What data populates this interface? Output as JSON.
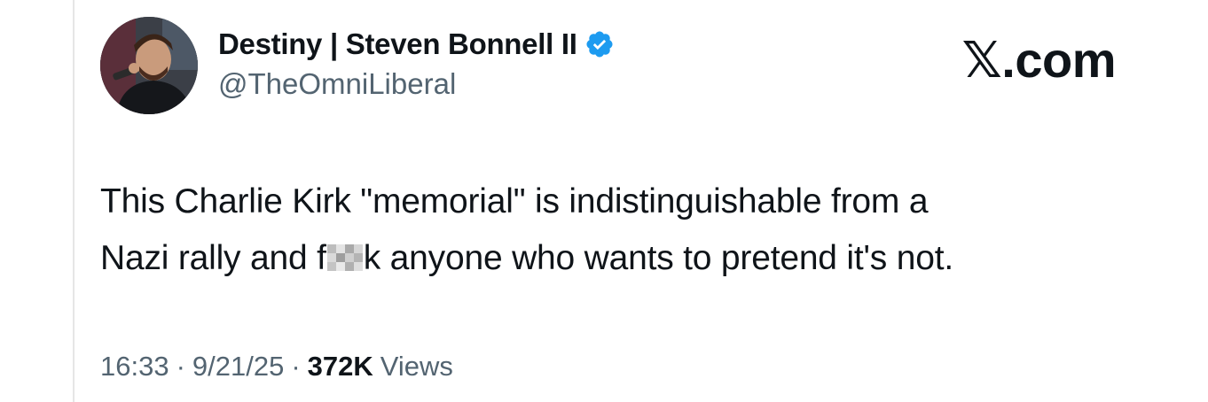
{
  "author": {
    "display_name": "Destiny | Steven Bonnell II",
    "handle": "@TheOmniLiberal",
    "verified_icon": "verified-badge-icon"
  },
  "brand": {
    "label": "𝕏.com"
  },
  "tweet": {
    "line1": "This Charlie Kirk \"memorial\" is indistinguishable from a",
    "line2_before": "Nazi rally and f",
    "line2_after": "k anyone who wants to pretend it's not."
  },
  "meta": {
    "time": "16:33",
    "separator": "·",
    "date": "9/21/25",
    "views_count": "372K",
    "views_label": "Views"
  },
  "colors": {
    "text_primary": "#0f1419",
    "text_secondary": "#536471",
    "verified_blue": "#1d9bf0"
  }
}
